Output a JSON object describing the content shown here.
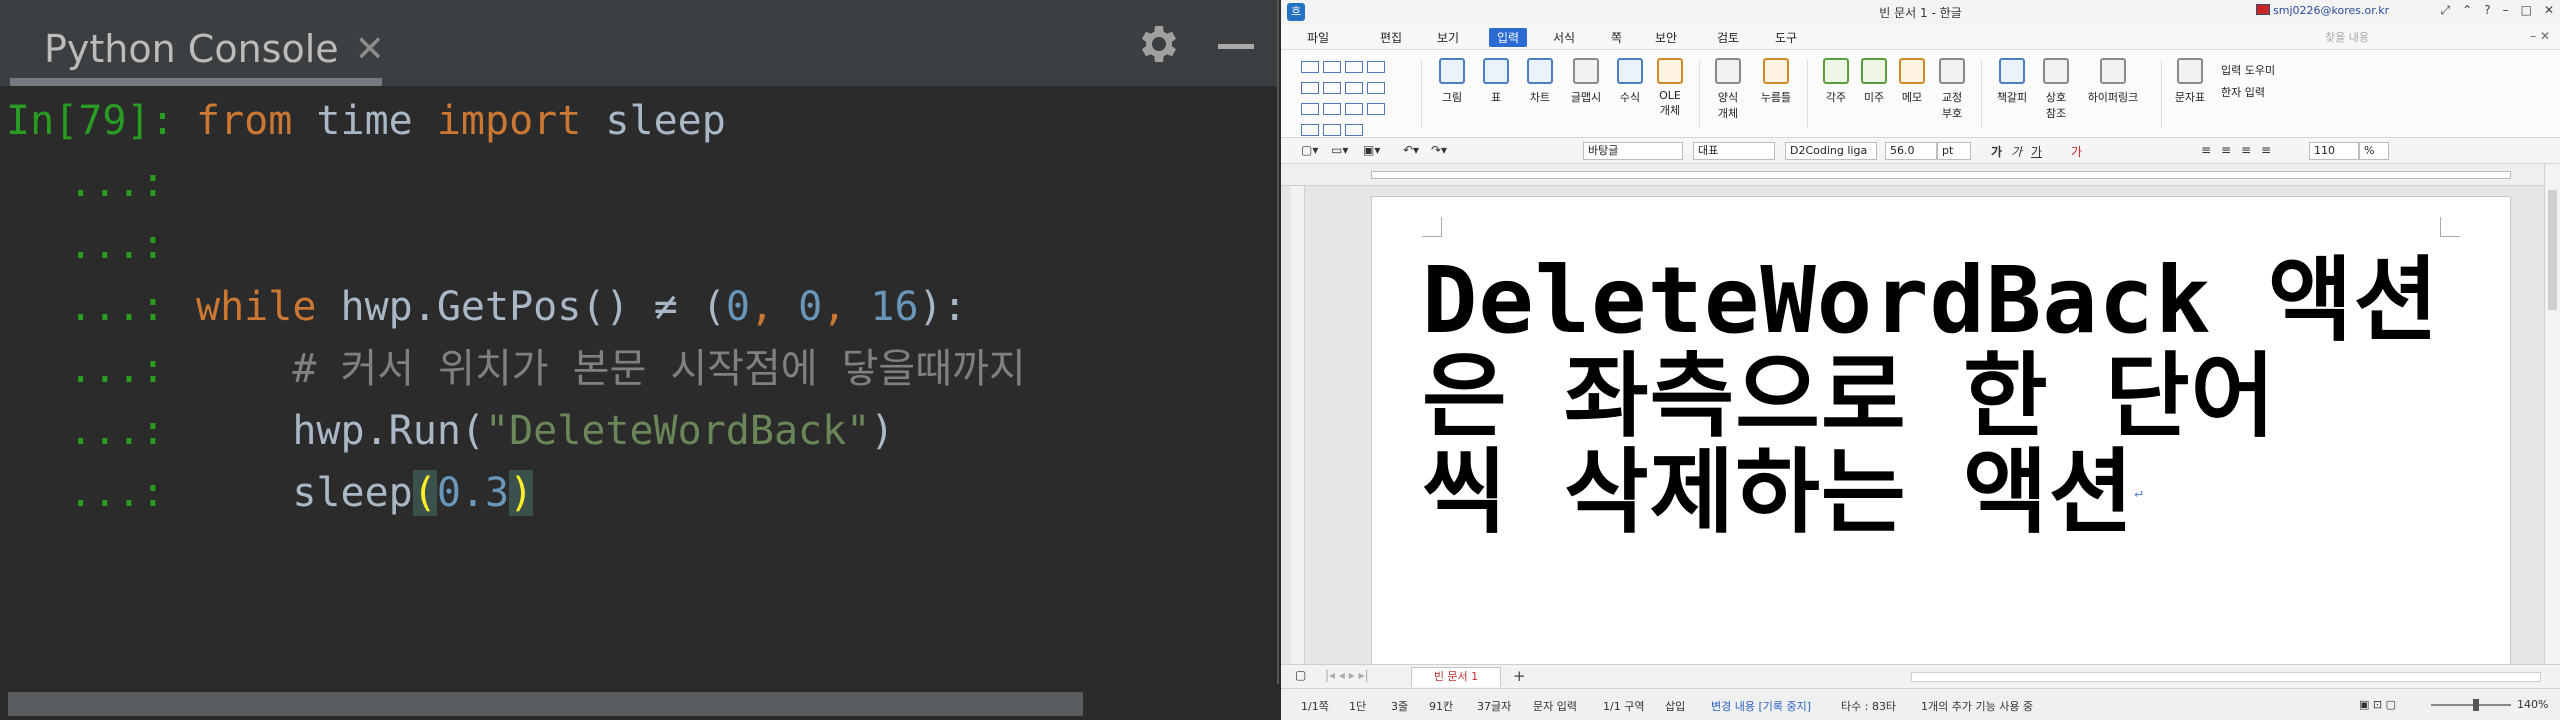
{
  "console": {
    "tab_title": "Python Console",
    "tab_close": "✕",
    "lines": [
      {
        "prompt": "In[79]:",
        "segments": [
          [
            "kw",
            "from"
          ],
          [
            "",
            "time"
          ],
          [
            "kw",
            "import"
          ],
          [
            "",
            "sleep"
          ]
        ]
      },
      {
        "prompt": "...:"
      },
      {
        "prompt": "...:"
      },
      {
        "prompt": "...:"
      },
      {
        "prompt": "...:"
      },
      {
        "prompt": "...:"
      },
      {
        "prompt": "...:"
      }
    ],
    "code": {
      "l1_kw_from": "from",
      "l1_mod": " time ",
      "l1_kw_import": "import",
      "l1_name": " sleep",
      "l4_kw_while": "while",
      "l4_call": " hwp.GetPos() ≠ (",
      "l4_n1": "0",
      "l4_c1": ", ",
      "l4_n2": "0",
      "l4_c2": ", ",
      "l4_n3": "16",
      "l4_end": "):",
      "l5_comment": "    # 커서 위치가 본문 시작점에 닿을때까지",
      "l6_call": "    hwp.Run(",
      "l6_str": "\"DeleteWordBack\"",
      "l6_end": ")",
      "l7_call": "    sleep",
      "l7_open": "(",
      "l7_num": "0.3",
      "l7_close": ")"
    },
    "prompts": {
      "first": "In[79]:",
      "cont": "...:"
    }
  },
  "hwp": {
    "app_logo": "흐",
    "title": "빈 문서 1 - 한글",
    "user": "smj0226@kores.or.kr",
    "menu": {
      "file": "파일",
      "edit": "편집",
      "view": "보기",
      "insert": "입력",
      "format": "서식",
      "page": "쪽",
      "security": "보안",
      "review": "검토",
      "tools": "도구",
      "search_placeholder": "찾을 내용"
    },
    "ribbon": {
      "picture": "그림",
      "table": "표",
      "chart": "차트",
      "textart": "글맵시",
      "equation": "수식",
      "ole1": "OLE",
      "ole2": "개체",
      "form1": "양식",
      "form2": "개체",
      "button": "누름틀",
      "footnote": "각주",
      "endnote": "미주",
      "memo": "메모",
      "proof1": "교정",
      "proof2": "부호",
      "bookmark": "책갈피",
      "cross1": "상호",
      "cross2": "참조",
      "hyperlink": "하이퍼링크",
      "symbol": "문자표",
      "input_helper": "입력 도우미",
      "hanja": "한자 입력"
    },
    "toolbar": {
      "style": "바탕글",
      "lang": "대표",
      "font": "D2Coding liga",
      "size": "56.0",
      "unit": "pt",
      "zoom": "110",
      "zoom_unit": "%"
    },
    "document": {
      "line1": "DeleteWordBack 액션",
      "line2": "은 좌측으로 한 단어",
      "line3": "씩 삭제하는 액션",
      "para_mark": "↵"
    },
    "tab": {
      "doc": "빈 문서 1",
      "add": "+"
    },
    "status": {
      "page": "1/1쪽",
      "section_col": "1단",
      "line": "3줄",
      "col": "91칸",
      "chars": "37글자",
      "mode": "문자 입력",
      "area": "1/1 구역",
      "insert": "삽입",
      "track": "변경 내용 [기록 중지]",
      "typing": "타수 : 83타",
      "extra": "1개의 추가 기능 사용 중",
      "zoom": "140%"
    }
  }
}
